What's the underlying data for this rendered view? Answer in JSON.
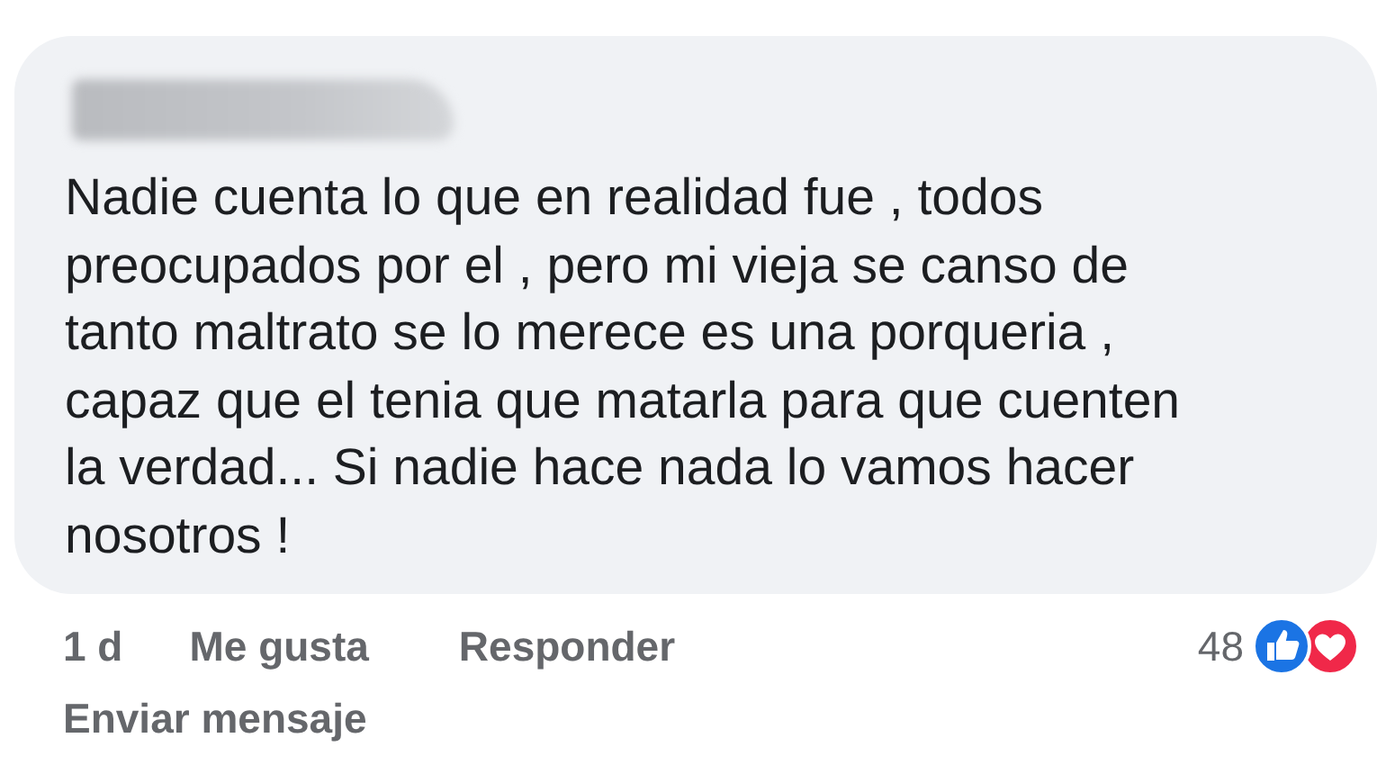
{
  "comment": {
    "text": "Nadie cuenta lo que en realidad fue , todos\npreocupados por el , pero mi vieja se canso de\ntanto maltrato se lo merece es una porqueria ,\ncapaz que el tenia que matarla para que cuenten\nla verdad... Si nadie hace nada lo vamos hacer\nnosotros !"
  },
  "actions": [
    {
      "kind": "time",
      "label": "1 d"
    },
    {
      "kind": "link",
      "label": "Me gusta"
    },
    {
      "kind": "link",
      "label": "Responder"
    }
  ],
  "reactions": {
    "count": "48"
  },
  "secondary_action": "Enviar mensaje"
}
